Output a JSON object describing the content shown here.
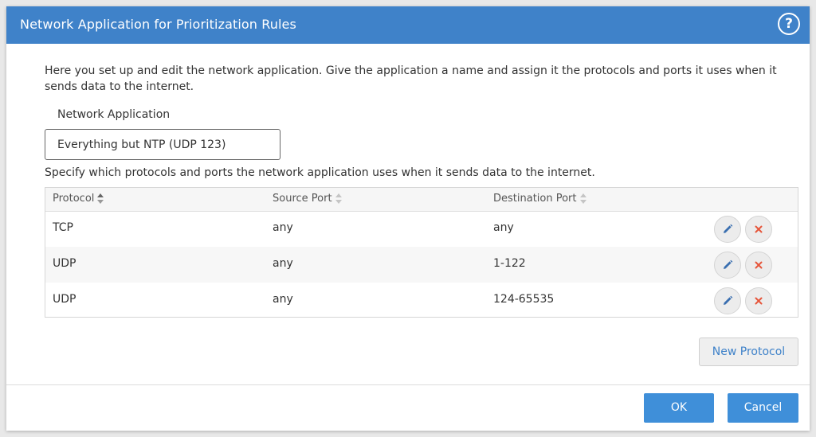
{
  "dialog": {
    "title": "Network Application for Prioritization Rules",
    "help_label": "?"
  },
  "intro": {
    "text": "Here you set up and edit the network application. Give the application a name and assign it the protocols and ports it uses when it sends data to the internet."
  },
  "field": {
    "label": "Network Application",
    "value": "Everything but NTP (UDP 123)"
  },
  "spec_text": "Specify which protocols and ports the network application uses when it sends data to the internet.",
  "table": {
    "headers": [
      "Protocol",
      "Source Port",
      "Destination Port"
    ],
    "rows": [
      [
        "TCP",
        "any",
        "any"
      ],
      [
        "UDP",
        "any",
        "1-122"
      ],
      [
        "UDP",
        "any",
        "124-65535"
      ]
    ]
  },
  "buttons": {
    "new_protocol": "New Protocol",
    "ok": "OK",
    "cancel": "Cancel"
  },
  "colors": {
    "titlebar": "#3f82c9",
    "primary": "#3f8fd9",
    "edit_icon": "#3a6fb0",
    "delete_icon": "#e6553a"
  },
  "icons": {
    "help": "help-icon",
    "edit": "pencil-icon",
    "delete": "close-icon",
    "sort": "sort-arrows-icon"
  }
}
